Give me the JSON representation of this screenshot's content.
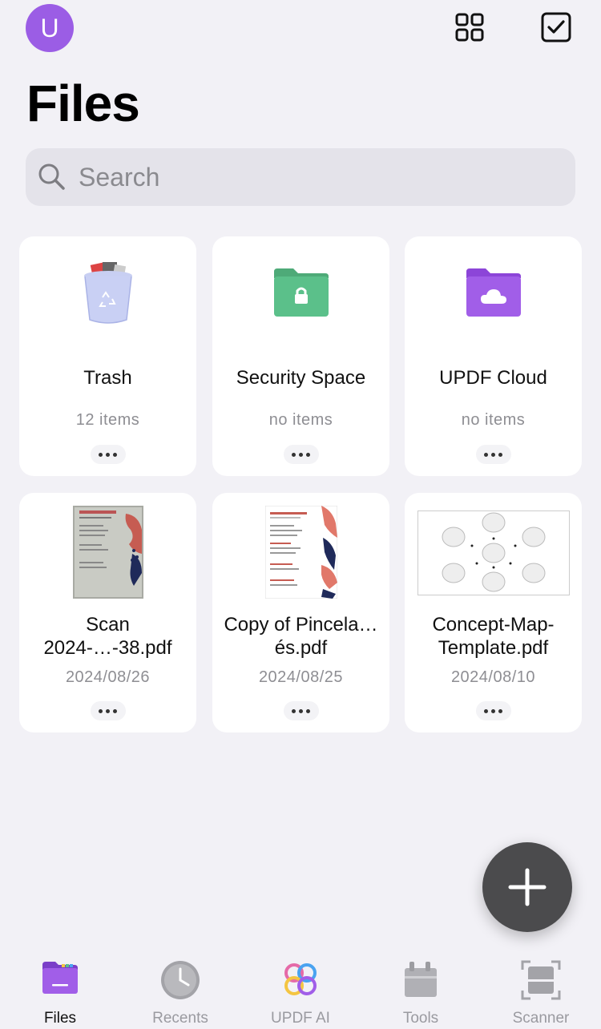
{
  "header": {
    "avatar_letter": "U",
    "title": "Files",
    "icons": [
      "grid-view-icon",
      "select-checkbox-icon"
    ]
  },
  "search": {
    "placeholder": "Search",
    "value": ""
  },
  "folders": [
    {
      "name": "Trash",
      "count": "12 items",
      "icon": "trash-icon"
    },
    {
      "name": "Security Space",
      "count": "no items",
      "icon": "locked-folder-icon",
      "color": "#5bc08a"
    },
    {
      "name": "UPDF Cloud",
      "count": "no items",
      "icon": "cloud-folder-icon",
      "color": "#a15ee8"
    }
  ],
  "files": [
    {
      "name": "Scan 2024-…-38.pdf",
      "date": "2024/08/26"
    },
    {
      "name": "Copy of Pincela…és.pdf",
      "date": "2024/08/25"
    },
    {
      "name": "Concept-Map-Template.pdf",
      "date": "2024/08/10"
    }
  ],
  "fab": {
    "icon": "plus-icon"
  },
  "tabs": [
    {
      "label": "Files",
      "icon": "files-folder-icon",
      "active": true
    },
    {
      "label": "Recents",
      "icon": "clock-icon",
      "active": false
    },
    {
      "label": "UPDF AI",
      "icon": "updf-ai-icon",
      "active": false
    },
    {
      "label": "Tools",
      "icon": "toolbox-icon",
      "active": false
    },
    {
      "label": "Scanner",
      "icon": "scanner-icon",
      "active": false
    }
  ],
  "colors": {
    "accent": "#9b5de5",
    "background": "#f2f1f6",
    "fab": "#4b4b4d"
  }
}
